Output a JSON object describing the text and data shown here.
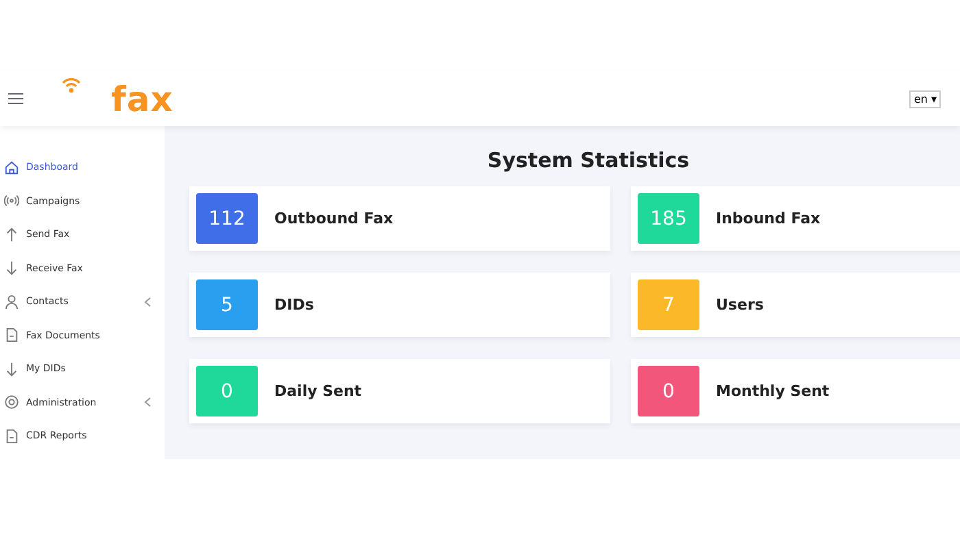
{
  "header": {
    "logo_text": "fax",
    "language": "en ▾"
  },
  "sidebar": {
    "items": [
      {
        "label": "Dashboard",
        "selected": true,
        "has_submenu": false
      },
      {
        "label": "Campaigns",
        "selected": false,
        "has_submenu": false
      },
      {
        "label": "Send Fax",
        "selected": false,
        "has_submenu": false
      },
      {
        "label": "Receive Fax",
        "selected": false,
        "has_submenu": false
      },
      {
        "label": "Contacts",
        "selected": false,
        "has_submenu": true
      },
      {
        "label": "Fax Documents",
        "selected": false,
        "has_submenu": false
      },
      {
        "label": "My DIDs",
        "selected": false,
        "has_submenu": false
      },
      {
        "label": "Administration",
        "selected": false,
        "has_submenu": true
      },
      {
        "label": "CDR Reports",
        "selected": false,
        "has_submenu": false
      }
    ]
  },
  "main": {
    "title": "System Statistics",
    "stats": [
      {
        "value": "112",
        "label": "Outbound Fax",
        "color": "#3f6ee8"
      },
      {
        "value": "185",
        "label": "Inbound Fax",
        "color": "#1ed99a"
      },
      {
        "value": "5",
        "label": "DIDs",
        "color": "#2a9ff0"
      },
      {
        "value": "7",
        "label": "Users",
        "color": "#fbb92a"
      },
      {
        "value": "0",
        "label": "Daily Sent",
        "color": "#1ed99a"
      },
      {
        "value": "0",
        "label": "Monthly Sent",
        "color": "#f2567a"
      }
    ]
  }
}
